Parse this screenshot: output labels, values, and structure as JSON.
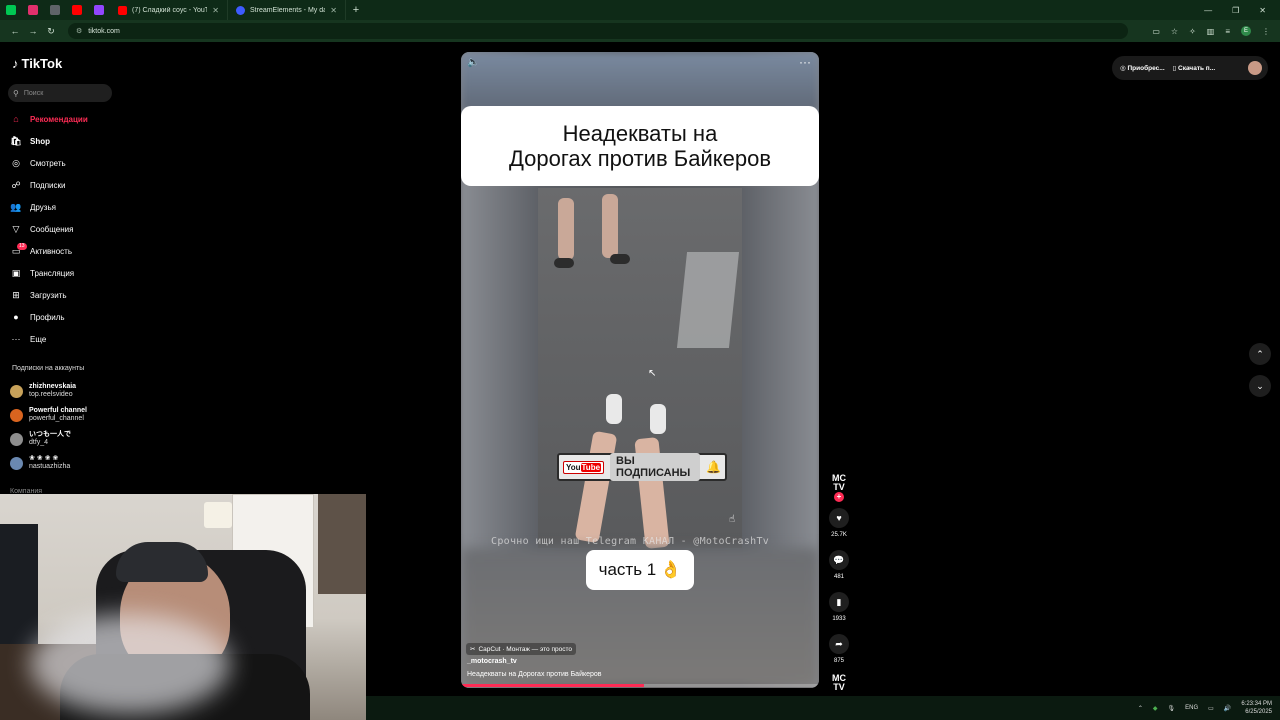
{
  "browser": {
    "tabs": [
      {
        "title": "(7) Сладкий соус - YouTube",
        "color": "#ff0000"
      },
      {
        "title": "StreamElements - My dashboard",
        "color": "#3e5bff"
      }
    ],
    "mini_tabs": [
      "#00c853",
      "#e1306c",
      "#5f6368",
      "#ff0000",
      "#9146ff"
    ],
    "new_tab": "+",
    "url": "tiktok.com",
    "window_controls": [
      "—",
      "❐",
      "✕"
    ],
    "profile_letter": "E"
  },
  "tiktok": {
    "logo": "TikTok",
    "search_placeholder": "Поиск",
    "nav": [
      {
        "label": "Рекомендации",
        "icon": "home-icon",
        "glyph": "⌂",
        "active": true
      },
      {
        "label": "Shop",
        "icon": "shop-icon",
        "glyph": "🛍",
        "bold": true
      },
      {
        "label": "Смотреть",
        "icon": "compass-icon",
        "glyph": "◎"
      },
      {
        "label": "Подписки",
        "icon": "following-icon",
        "glyph": "☍"
      },
      {
        "label": "Друзья",
        "icon": "friends-icon",
        "glyph": "👥"
      },
      {
        "label": "Сообщения",
        "icon": "messages-icon",
        "glyph": "▽"
      },
      {
        "label": "Активность",
        "icon": "activity-icon",
        "glyph": "▭",
        "badge": "13"
      },
      {
        "label": "Трансляция",
        "icon": "live-icon",
        "glyph": "▣"
      },
      {
        "label": "Загрузить",
        "icon": "upload-icon",
        "glyph": "⊞"
      },
      {
        "label": "Профиль",
        "icon": "profile-icon",
        "glyph": "●"
      },
      {
        "label": "Еще",
        "icon": "more-icon",
        "glyph": "···"
      }
    ],
    "subscriptions_title": "Подписки на аккаунты",
    "subscriptions": [
      {
        "name": "zhizhnevskaia",
        "handle": "top.reelsvideo",
        "color": "#c8a25a"
      },
      {
        "name": "Powerful channel",
        "handle": "powerful_channel",
        "color": "#d9641f"
      },
      {
        "name": "いつも一人で",
        "handle": "dtfy_4",
        "color": "#8e8e8e"
      },
      {
        "name": "❀ ❀ ❀ ❀",
        "handle": "nastuazhizha",
        "color": "#6a88b0"
      }
    ],
    "cut_label": "Компания"
  },
  "video": {
    "title_line1": "Неадекваты на",
    "title_line2": "Дорогах против Байкеров",
    "subscribed_badge": "ВЫ ПОДПИСАНЫ",
    "yt_logo": "You",
    "yt_logo_tube": "Tube",
    "telegram_text": "Срочно ищи наш Telegram КАНАЛ - @MotoCrashTv",
    "part_label": "часть 1",
    "part_emoji": "👌",
    "capcut_label": "CapCut · Монтаж — это просто",
    "author": "_motocrash_tv",
    "description": "Неадекваты на Дорогах против Байкеров",
    "progress": 0.51
  },
  "actions": {
    "avatar_text": "MC TV",
    "likes": "25.7K",
    "comments": "481",
    "saves": "1933",
    "shares": "875"
  },
  "topright": {
    "get_coins": "Приобрес...",
    "download": "Скачать п..."
  },
  "taskbar": {
    "lang": "ENG",
    "time": "6:23:34 PM",
    "date": "6/25/2025"
  }
}
